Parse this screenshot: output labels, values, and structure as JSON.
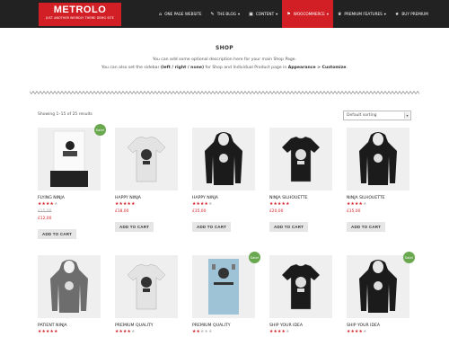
{
  "header": {
    "logo_name": "METROLO",
    "logo_tagline": "JUST ANOTHER WEIRDLY THEME DEMO SITE",
    "nav": [
      {
        "label": "ONE PAGE WEBSITE",
        "icon": "home-icon",
        "symbol": "⌂",
        "active": false
      },
      {
        "label": "THE BLOG",
        "icon": "pin-icon",
        "symbol": "✎",
        "active": false
      },
      {
        "label": "CONTENT",
        "icon": "image-icon",
        "symbol": "▣",
        "active": false
      },
      {
        "label": "WOOCOMMERCE",
        "icon": "cart-icon",
        "symbol": "⚑",
        "active": true
      },
      {
        "label": "PREMIUM FEATURES",
        "icon": "trophy-icon",
        "symbol": "♛",
        "active": false
      },
      {
        "label": "BUY PREMIUM",
        "icon": "star-icon",
        "symbol": "★",
        "active": false
      }
    ],
    "nav_suffix": "▾"
  },
  "shop": {
    "title": "SHOP",
    "desc_line1": "You can add some optional description here for your main Shop Page.",
    "desc_line2_a": "You can also set the sidebar ",
    "desc_line2_b": "(left / right / none)",
    "desc_line2_c": " for Shop and Individual Product page in ",
    "desc_line2_d": "Appearance > Customize",
    "desc_line2_e": ".",
    "results": "Showing 1–15 of 25 results",
    "sort_selected": "Default sorting",
    "sort_arrow": "▾"
  },
  "products": [
    {
      "name": "FLYING NINJA",
      "rating": 4,
      "old_price": "£15,00",
      "price": "£12,00",
      "sale": true,
      "sale_label": "Sale!",
      "button": "ADD TO CART",
      "kind": "poster"
    },
    {
      "name": "HAPPY NINJA",
      "rating": 5,
      "old_price": "",
      "price": "£18,00",
      "sale": false,
      "sale_label": "",
      "button": "ADD TO CART",
      "kind": "tshirt-light"
    },
    {
      "name": "HAPPY NINJA",
      "rating": 4,
      "old_price": "",
      "price": "£35,00",
      "sale": false,
      "sale_label": "",
      "button": "ADD TO CART",
      "kind": "hoodie-dark"
    },
    {
      "name": "NINJA SILHOUETTE",
      "rating": 5,
      "old_price": "",
      "price": "£20,00",
      "sale": false,
      "sale_label": "",
      "button": "ADD TO CART",
      "kind": "tshirt-dark"
    },
    {
      "name": "NINJA SILHOUETTE",
      "rating": 4,
      "old_price": "",
      "price": "£35,00",
      "sale": false,
      "sale_label": "",
      "button": "ADD TO CART",
      "kind": "hoodie-dark"
    },
    {
      "name": "PATIENT NINJA",
      "rating": 5,
      "old_price": "",
      "price": "",
      "sale": false,
      "sale_label": "",
      "button": "",
      "kind": "hoodie-grey"
    },
    {
      "name": "PREMIUM QUALITY",
      "rating": 4,
      "old_price": "",
      "price": "",
      "sale": false,
      "sale_label": "",
      "button": "",
      "kind": "tshirt-light"
    },
    {
      "name": "PREMIUM QUALITY",
      "rating": 2,
      "old_price": "",
      "price": "",
      "sale": true,
      "sale_label": "Sale!",
      "button": "",
      "kind": "poster-blue"
    },
    {
      "name": "SHIP YOUR IDEA",
      "rating": 4,
      "old_price": "",
      "price": "",
      "sale": false,
      "sale_label": "",
      "button": "",
      "kind": "tshirt-dark"
    },
    {
      "name": "SHIP YOUR IDEA",
      "rating": 4,
      "old_price": "",
      "price": "",
      "sale": true,
      "sale_label": "Sale!",
      "button": "",
      "kind": "hoodie-dark"
    }
  ],
  "colors": {
    "accent": "#d21f26",
    "topbar": "#222222",
    "sale_badge": "#6aa84f"
  }
}
